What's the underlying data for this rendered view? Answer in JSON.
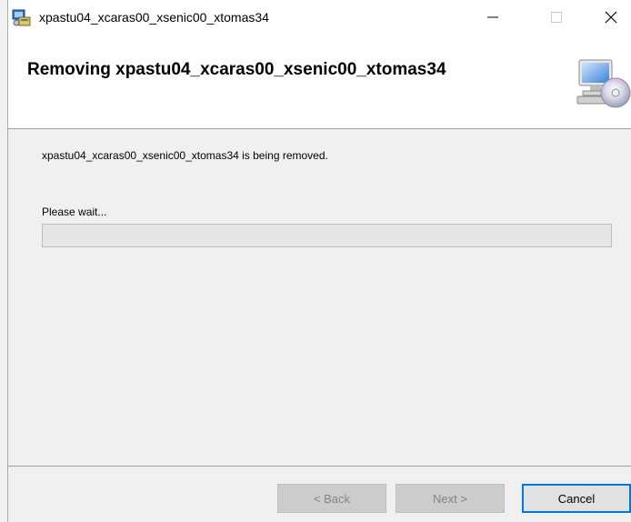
{
  "window": {
    "title": "xpastu04_xcaras00_xsenic00_xtomas34",
    "minimize_glyph": "—",
    "maximize_glyph": "☐",
    "close_glyph": "✕"
  },
  "banner": {
    "title": "Removing xpastu04_xcaras00_xsenic00_xtomas34",
    "icon": "computer-cd-icon"
  },
  "body": {
    "message": "xpastu04_xcaras00_xsenic00_xtomas34 is being removed.",
    "wait_label": "Please wait...",
    "progress": 0
  },
  "footer": {
    "back_label": "< Back",
    "next_label": "Next >",
    "cancel_label": "Cancel"
  },
  "colors": {
    "focus_border": "#0078d7",
    "progress_fill": "#06b025"
  }
}
